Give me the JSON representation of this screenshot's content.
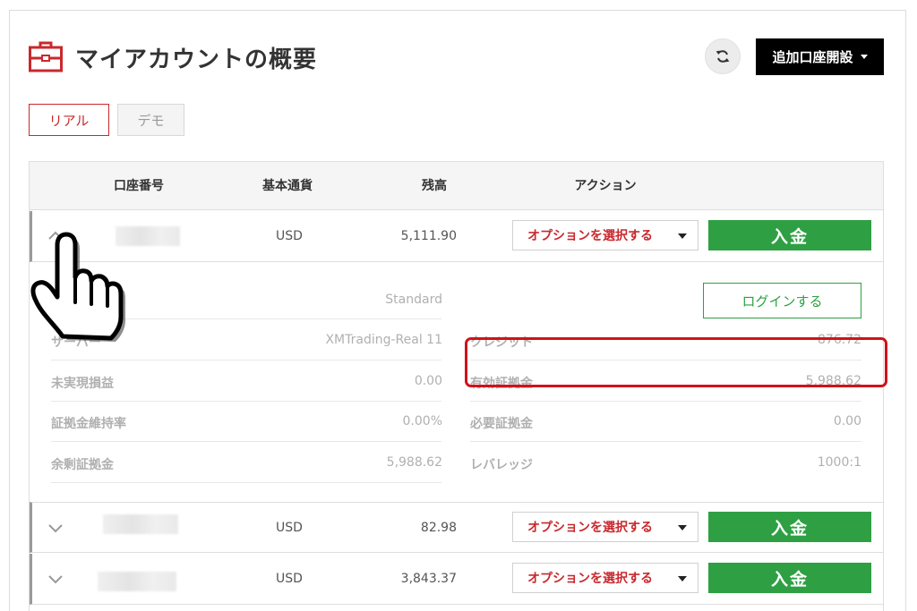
{
  "header": {
    "title": "マイアカウントの概要",
    "open_account_label": "追加口座開設",
    "icons": {
      "briefcase": "briefcase-icon",
      "refresh": "refresh-icon",
      "dropdown": "caret-down-icon"
    }
  },
  "tabs": [
    {
      "label": "リアル",
      "active": true
    },
    {
      "label": "デモ",
      "active": false
    }
  ],
  "table": {
    "columns": [
      "口座番号",
      "基本通貨",
      "残高",
      "アクション"
    ],
    "rows": [
      {
        "account_number": "",
        "currency": "USD",
        "balance": "5,111.90",
        "expanded": true,
        "option_label": "オプションを選択する",
        "deposit_label": "入金"
      },
      {
        "account_number": "",
        "currency": "USD",
        "balance": "82.98",
        "expanded": false,
        "option_label": "オプションを選択する",
        "deposit_label": "入金"
      },
      {
        "account_number": "",
        "currency": "USD",
        "balance": "3,843.37",
        "expanded": false,
        "option_label": "オプションを選択する",
        "deposit_label": "入金"
      }
    ]
  },
  "details": {
    "account_type_value": "Standard",
    "login_label": "ログインする",
    "left": [
      {
        "label": "サーバー",
        "value": "XMTrading-Real 11"
      },
      {
        "label": "未実現損益",
        "value": "0.00"
      },
      {
        "label": "証拠金維持率",
        "value": "0.00%"
      },
      {
        "label": "余剰証拠金",
        "value": "5,988.62"
      }
    ],
    "right": [
      {
        "label": "クレジット",
        "value": "876.72"
      },
      {
        "label": "有効証拠金",
        "value": "5,988.62"
      },
      {
        "label": "必要証拠金",
        "value": "0.00"
      },
      {
        "label": "レバレッジ",
        "value": "1000:1"
      }
    ]
  },
  "colors": {
    "brand_red": "#c9282d",
    "deposit_green": "#2ea043",
    "highlight_red": "#d0121b"
  }
}
